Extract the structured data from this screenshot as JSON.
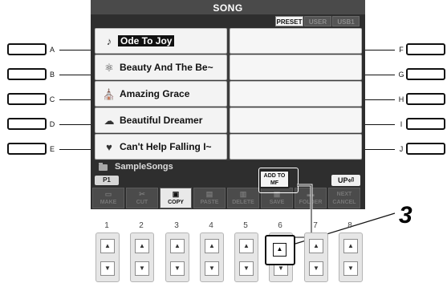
{
  "screen": {
    "title": "SONG",
    "tabs": [
      "PRESET",
      "USER",
      "USB1"
    ],
    "files_left": [
      {
        "letter": "A",
        "name": "Ode To Joy",
        "icon": "♪",
        "selected": true
      },
      {
        "letter": "B",
        "name": "Beauty And The Be~",
        "icon": "⚛",
        "selected": false
      },
      {
        "letter": "C",
        "name": "Amazing Grace",
        "icon": "⛪",
        "selected": false
      },
      {
        "letter": "D",
        "name": "Beautiful Dreamer",
        "icon": "☁",
        "selected": false
      },
      {
        "letter": "E",
        "name": "Can't Help Falling I~",
        "icon": "♥",
        "selected": false
      }
    ],
    "right_letters": [
      "F",
      "G",
      "H",
      "I",
      "J"
    ],
    "folder_name": "SampleSongs",
    "page_label": "P1",
    "up_label": "UP⏎",
    "add_to_mf": [
      "ADD TO",
      "MF"
    ],
    "menu": [
      {
        "label": "MAKE",
        "icon": "music-folder-icon",
        "glyph": "▭",
        "active": false
      },
      {
        "label": "CUT",
        "icon": "scissors-icon",
        "glyph": "✂",
        "active": false
      },
      {
        "label": "COPY",
        "icon": "copy-icon",
        "glyph": "▣",
        "active": true
      },
      {
        "label": "PASTE",
        "icon": "paste-icon",
        "glyph": "▤",
        "active": false
      },
      {
        "label": "DELETE",
        "icon": "trash-icon",
        "glyph": "▥",
        "active": false
      },
      {
        "label": "SAVE",
        "icon": "save-icon",
        "glyph": "▦",
        "active": false
      },
      {
        "label": "FOLDER",
        "icon": "folder-icon",
        "glyph": "▬",
        "active": false
      },
      {
        "label": "CANCEL",
        "icon": "next-icon",
        "glyph": "NEXT",
        "active": false
      }
    ]
  },
  "number_buttons": [
    "1",
    "2",
    "3",
    "4",
    "5",
    "6",
    "7",
    "8"
  ],
  "arrow_up_glyph": "▲",
  "arrow_down_glyph": "▼",
  "step": "3",
  "colors": {
    "screen_bg": "#2e2e2e",
    "cell_bg": "#f3f3f3",
    "selected_text_bg": "#111111"
  }
}
